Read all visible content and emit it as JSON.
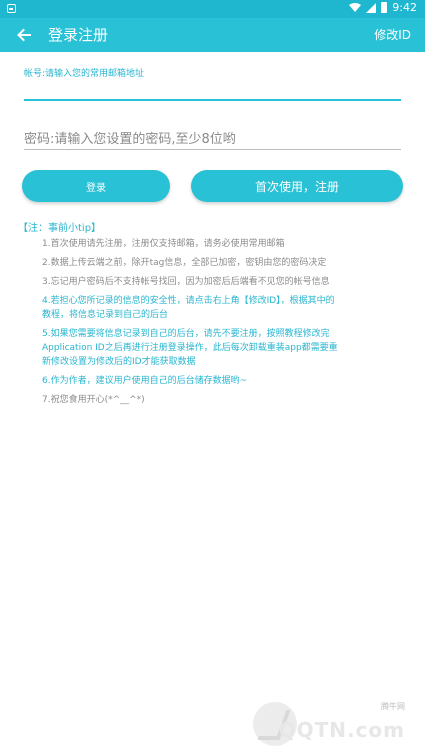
{
  "status_bar": {
    "time": "9:42"
  },
  "app_bar": {
    "title": "登录注册",
    "action": "修改ID"
  },
  "form": {
    "account_label": "帐号:请输入您的常用邮箱地址",
    "password_placeholder": "密码:请输入您设置的密码,至少8位哟"
  },
  "buttons": {
    "login": "登录",
    "register": "首次使用，注册"
  },
  "tips": {
    "title": "【注：事前小tip】",
    "items": [
      "1.首次使用请先注册，注册仅支持邮箱，请务必使用常用邮箱",
      "2.数据上传云端之前，除开tag信息，全部已加密，密钥由您的密码决定",
      "3.忘记用户密码后不支持帐号找回，因为加密后后端看不见您的帐号信息",
      "4.若担心您所记录的信息的安全性，请点击右上角【修改ID】，根据其中的",
      "教程，将信息记录到自己的后台",
      "5.如果您需要将信息记录到自己的后台，请先不要注册，按照教程修改完",
      "Application ID之后再进行注册登录操作，此后每次卸载重装app都需要重",
      "新修改设置为修改后的ID才能获取数据",
      "6.作为作者，建议用户使用自己的后台储存数据哟~",
      "7.祝您食用开心(*^__^*)"
    ]
  },
  "watermark": {
    "cn": "腾牛网",
    "en": "QQTN.com"
  },
  "colors": {
    "primary": "#29c1d6",
    "status_bar": "#1fb7cf",
    "tip_highlight": "#29b6d0",
    "tip_normal": "#8c8c8c"
  },
  "icons": [
    "notification-icon",
    "signal-icon",
    "wifi-icon",
    "battery-icon",
    "back-arrow-icon",
    "watermark-logo-icon"
  ]
}
